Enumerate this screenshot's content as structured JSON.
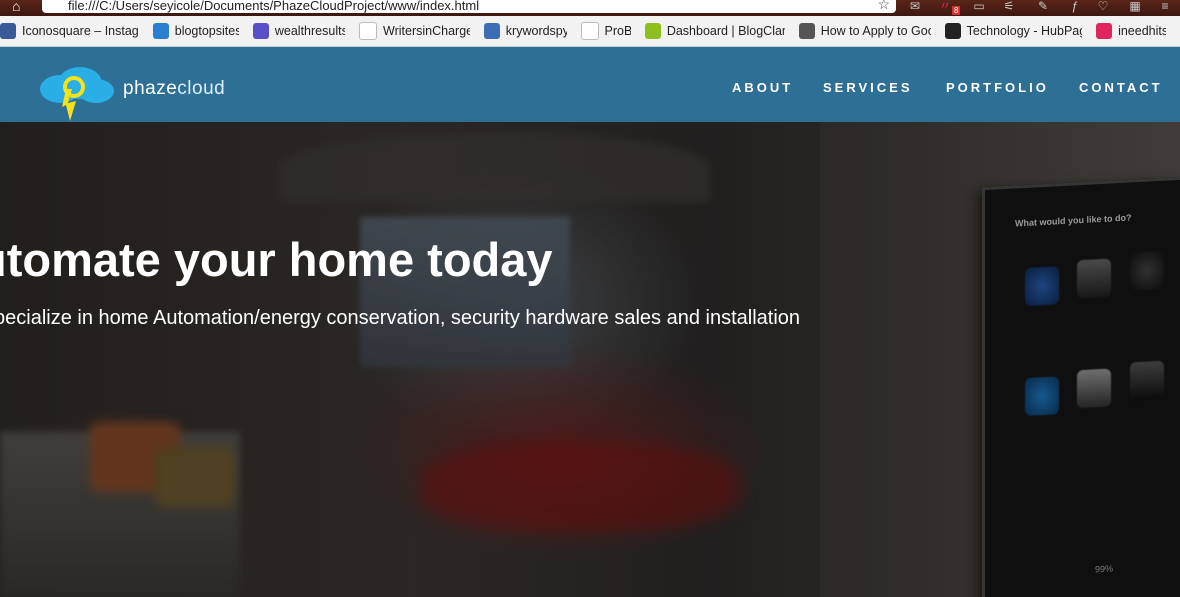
{
  "browser": {
    "address": "file:///C:/Users/seyicole/Documents/PhazeCloudProject/www/index.html",
    "extension_badge": "8"
  },
  "bookmarks": [
    {
      "label": "Iconosquare – Instagr",
      "icon": "iconosquare-icon",
      "color": "#3b5998"
    },
    {
      "label": "blogtopsites",
      "icon": "blogtopsites-icon",
      "color": "#2a7fd1"
    },
    {
      "label": "wealthresults",
      "icon": "wealthresults-icon",
      "color": "#5b4fc9"
    },
    {
      "label": "WritersinCharge",
      "icon": "google-icon",
      "color": "#ffffff"
    },
    {
      "label": "krywordspy",
      "icon": "krywordspy-icon",
      "color": "#3d6db5"
    },
    {
      "label": "ProB",
      "icon": "page-icon",
      "color": "#ffffff"
    },
    {
      "label": "Dashboard | BlogClan",
      "icon": "blogclan-icon",
      "color": "#8fbf1f"
    },
    {
      "label": "How to Apply to Goo",
      "icon": "link-icon",
      "color": "#555555"
    },
    {
      "label": "Technology - HubPag",
      "icon": "hubpages-icon",
      "color": "#222222"
    },
    {
      "label": "ineedhits",
      "icon": "ineedhits-icon",
      "color": "#e0245e"
    }
  ],
  "site": {
    "brand_bold": "phaze",
    "brand_light": "cloud",
    "nav": [
      "ABOUT",
      "SERVICES",
      "PORTFOLIO",
      "CONTACT"
    ],
    "nav_color": "#2d6f95"
  },
  "hero": {
    "headline": "utomate your home today",
    "subline": "pecialize in home Automation/energy conservation, security hardware sales and installation",
    "panel_title": "What would you like to do?",
    "panel_footer": "99%"
  }
}
